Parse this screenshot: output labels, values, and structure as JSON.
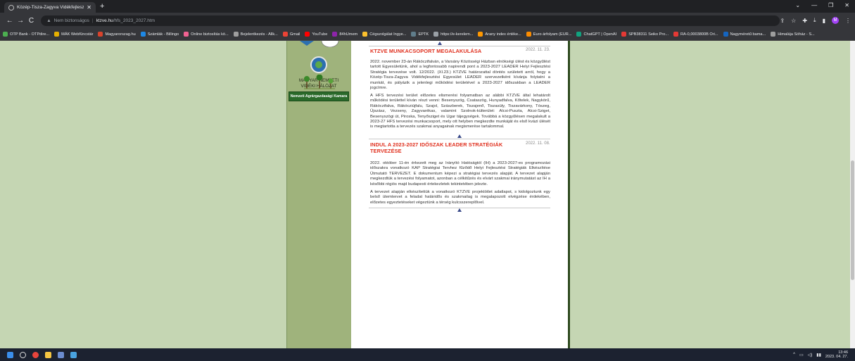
{
  "browser": {
    "tab_title": "Közép-Tisza-Zagyva Vidékfejlesz",
    "new_tab": "+",
    "security_label": "Nem biztonságos",
    "url_host": "ktzve.hu",
    "url_path": "/hfs_2023_2027.htm",
    "bookmarks": [
      "OTP Bank - OTPdire...",
      "MÁK WebKincstár",
      "Magyarorszag.hu",
      "Számlák - Billingo",
      "Online biztosítás kö...",
      "Bejelentkezés - Allk...",
      "Gmail",
      "YouTube",
      "84hUmem",
      "Cégszolgálat Ingye...",
      "EPTK",
      "https://e-kerelem...",
      "Arany index értéke...",
      "Euro árfolyam (EUR...",
      "ChatGPT | OpenAI",
      "SPB38311 Seiko Pro...",
      "RA-0,0003800B Ori...",
      "Nagyméretű bama...",
      "Himalája Sóház - S..."
    ],
    "profile_letter": "M"
  },
  "sidebar": {
    "mnvh_label": "MAGYAR NEMZETI VIDÉKI HÁLÓZAT",
    "nak_label": "Nemzeti Agrárgazdasági Kamara"
  },
  "articles": [
    {
      "title": "KTZVE MUNKACSOPORT MEGALAKULÁSA",
      "date": "2022. 11. 23.",
      "paragraphs": [
        "2022. november 23-án Rákóczifalván, a Varsány Közösségi Házban elnökségi ülést és közgyűlést tartott Egyesületünk, ahol a legfontosabb napirendi pont a 2023-2027 LEADER Helyi Fejlesztési Stratégia tervezése volt. 12/2022. (XI.23.) KTZVE határozattal döntés született arról, hogy a Közép-Tisza-Zagyva Vidékfejlesztési Egyesület LEADER szervezetként kívánja folytatni a munkát, és pályázik a jelenlegi működési területével a 2023-2027 időszakban a LEADER jogcímre.",
        "A HFS tervezési terület előzetes elismerési folyamatban az alábbi KTZVE által lehatárolt működési területtel kíván részt venni: Besenyszög, Csataszög, Hunyadfalva, Kőtelek, Nagykörű, Rákóczifalva, Rákócziújfalu, Szajol, Szászberek, Tiszajenő, Tiszasüly, Tiszavárkony, Tószeg, Újszász, Vezseny, Zagyvarékas, valamint Szolnok-külterület: Alcsi-Puszta, Alcsi-Sziget, Besenyszögi út, Piroska, Tenyősziget és Ugar tájegységek. Továbbá a közgyűlésen megalakult a 2023-27 HFS tervezési munkacsoport, mely ott helyben megkezdte munkáját és első kvázi ülését is megtartotta a tervezés szakmai anyagainak megismerése tartalommal."
      ]
    },
    {
      "title": "INDUL A 2023-2027 IDŐSZAK LEADER STRATÉGIÁK TERVEZÉSE",
      "date": "2022. 11. 08.",
      "paragraphs": [
        "2022. október 11-én érkezett meg az Irányító Hatóságtól (IH) a 2023-2027-es programozási időszakra vonatkozó KAP Stratégiai Tervhez fűződő Helyi Fejlesztési Stratégiák Elkészítése Útmutató TERVEZET. E dokumentum képezi a stratégiai tervezés alapját. A tervezet alapján megkezdtük a tervezési folyamatot, azonban a célkitűzés és elvárt szakmai iránymutatást az IH a későbbi régiós majd budapesti értekezletek tekintetében jelezte.",
        "A tervezet alapján elkészítettük a vonatkozó KTZVE projektötlet adatlapot, s kidolgoztunk egy belső ütemtervet a feladat határidős és szakmailag is megalapozott elvégzése érdekében, előzetes egyeztetéseket végeztünk a térség kulcsszereplőivel."
      ]
    }
  ],
  "taskbar": {
    "time": "13:46",
    "date": "2023. 04. 27."
  }
}
